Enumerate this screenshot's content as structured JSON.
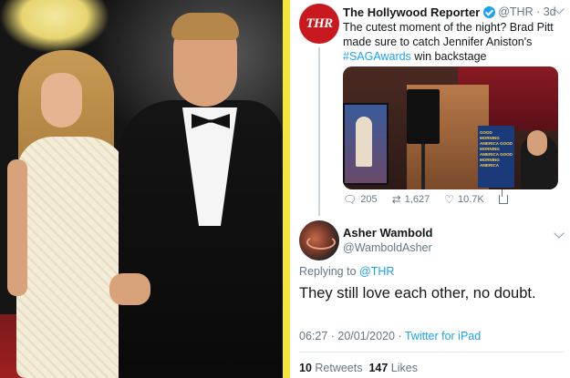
{
  "tweet": {
    "avatar_text": "THR",
    "name": "The Hollywood Reporter",
    "handle_time": "@THR · 3d",
    "text": "The cutest moment of the night? Brad Pitt made sure to catch Jennifer Aniston's ",
    "hashtag": "#SAGAwards",
    "text_end": " win backstage",
    "media_banner_text": "GOOD MORNING AMERICA GOOD MORNING AMERICA GOOD MORNING AMERICA",
    "actions": {
      "replies": "205",
      "retweets": "1,627",
      "likes": "10.7K"
    },
    "icons": {
      "reply": "reply-icon",
      "retweet": "retweet-icon",
      "like": "heart-icon",
      "share": "share-icon",
      "verified": "verified-badge-icon",
      "chevron": "chevron-down-icon"
    }
  },
  "reply": {
    "name": "Asher Wambold",
    "handle": "@WamboldAsher",
    "replying_prefix": "Replying to ",
    "replying_to": "@THR",
    "text": "They still love each other, no doubt.",
    "time": "06:27 · 20/01/2020 · ",
    "via": "Twitter for iPad",
    "retweets_count": "10",
    "retweets_label": " Retweets  ",
    "likes_count": "147",
    "likes_label": " Likes"
  },
  "colors": {
    "accent": "#1da1f2",
    "divider": "#f7e53b",
    "thr_red": "#c8191f",
    "secondary_text": "#657786"
  }
}
